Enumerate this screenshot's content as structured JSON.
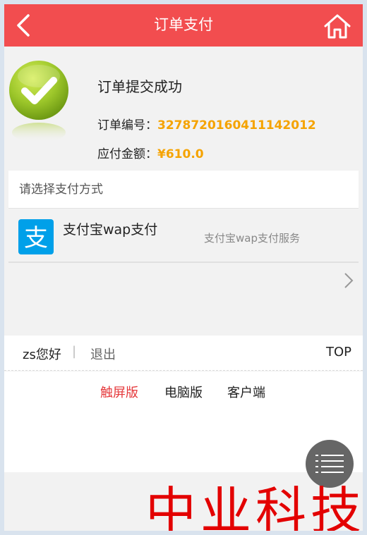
{
  "header": {
    "title": "订单支付",
    "back_icon": "chevron-left-icon",
    "home_icon": "home-icon",
    "bg_color": "#f24d4f"
  },
  "order": {
    "success_text": "订单提交成功",
    "number_label": "订单编号：",
    "number_value": "327872016041114201​2",
    "amount_label": "应付金额：",
    "amount_value": "¥610.0",
    "value_color": "#f5a300"
  },
  "payment": {
    "section_title": "请选择支付方式",
    "methods": [
      {
        "name": "支付宝wap支付",
        "description": "支付宝wap支付服务",
        "icon": "alipay-icon"
      }
    ]
  },
  "footer": {
    "greeting": "zs您好",
    "separator": "|",
    "logout": "退出",
    "top": "TOP",
    "links": [
      "触屏版",
      "电脑版",
      "客户端"
    ],
    "active_link": "触屏版",
    "active_color": "#e5383b"
  },
  "watermark": "中业科技"
}
